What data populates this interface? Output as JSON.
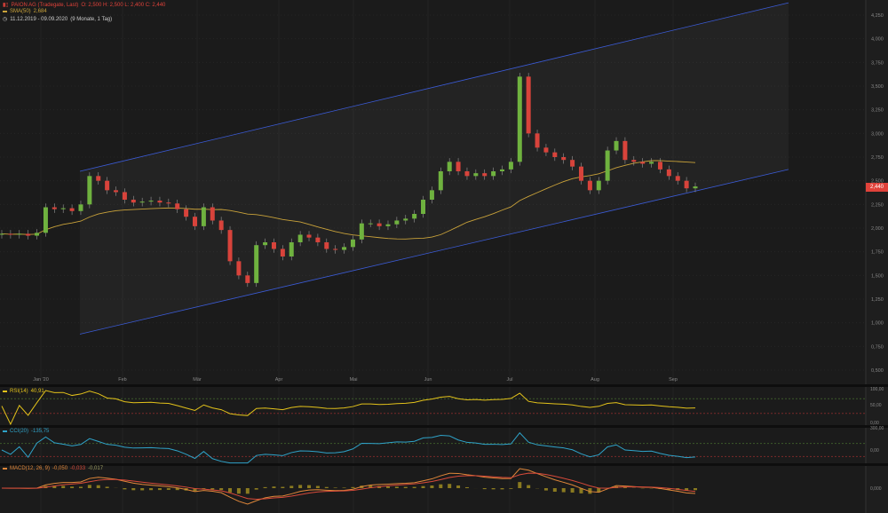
{
  "header": {
    "instrument": "PAION AG (Tradegate, Last)",
    "ohlc": "O: 2,500  H: 2,500  L: 2,400  C: 2,440",
    "sma_label": "SMA(50)",
    "sma_value": "2,684",
    "period": "11.12.2019 - 09.09.2020",
    "period_detail": "(9 Monate, 1 Tag)"
  },
  "last_price": "2,440",
  "colors": {
    "background": "#1b1b1b",
    "up": "#6fb23f",
    "down": "#d8433b",
    "sma": "#c9a23a",
    "channel": "#3b5bd6",
    "rsi": "#e3c21a",
    "cci": "#2fa3c9",
    "macd": "#e0873a",
    "signal": "#d84a3a",
    "histogram": "#8a7a20"
  },
  "chart_data": {
    "type": "candlestick",
    "y_axis": {
      "min": 0.5,
      "max": 4.25,
      "ticks": [
        "4,250",
        "4,000",
        "3,750",
        "3,500",
        "3,250",
        "3,000",
        "2,750",
        "2,500",
        "2,250",
        "2,000",
        "1,750",
        "1,500",
        "1,250",
        "1,000",
        "0,750",
        "0,500"
      ]
    },
    "x_ticks": [
      "Jan '20",
      "Feb",
      "Mär",
      "Apr",
      "Mai",
      "Jun",
      "Jul",
      "Aug",
      "Sep"
    ],
    "closes": [
      1.94,
      1.93,
      1.94,
      1.92,
      1.95,
      2.22,
      2.2,
      2.21,
      2.18,
      2.25,
      2.55,
      2.5,
      2.4,
      2.38,
      2.3,
      2.27,
      2.28,
      2.29,
      2.27,
      2.26,
      2.2,
      2.12,
      2.02,
      2.22,
      2.08,
      1.98,
      1.65,
      1.5,
      1.42,
      1.82,
      1.85,
      1.78,
      1.7,
      1.85,
      1.93,
      1.9,
      1.85,
      1.78,
      1.77,
      1.8,
      1.88,
      2.05,
      2.05,
      2.02,
      2.04,
      2.08,
      2.1,
      2.15,
      2.3,
      2.4,
      2.6,
      2.7,
      2.6,
      2.55,
      2.58,
      2.55,
      2.6,
      2.62,
      2.7,
      3.6,
      3.0,
      2.85,
      2.8,
      2.75,
      2.72,
      2.65,
      2.5,
      2.4,
      2.5,
      2.82,
      2.92,
      2.72,
      2.7,
      2.68,
      2.7,
      2.62,
      2.55,
      2.5,
      2.42,
      2.44
    ],
    "channel": {
      "upper": [
        2.6,
        4.38
      ],
      "lower": [
        0.88,
        2.62
      ]
    },
    "sma_period": 50
  },
  "indicators": {
    "rsi": {
      "label": "RSI(14)",
      "value": "40,91",
      "ticks": [
        "100,00",
        "50,00",
        "0,00"
      ]
    },
    "cci": {
      "label": "CCI(20)",
      "value": "-135,75",
      "ticks": [
        "300,00",
        "0,00"
      ]
    },
    "macd": {
      "label": "MACD(12, 26, 9)",
      "value1": "-0,050",
      "value2": "-0,033",
      "value3": "-0,017",
      "ticks": [
        "0,000"
      ]
    }
  }
}
